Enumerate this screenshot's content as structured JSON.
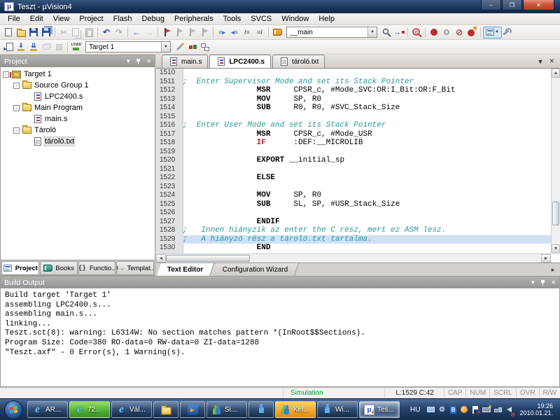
{
  "titlebar": {
    "title": "Teszt - µVision4"
  },
  "window_controls": {
    "minimize": "–",
    "maximize": "❐",
    "close": "✕"
  },
  "menubar": [
    "File",
    "Edit",
    "View",
    "Project",
    "Flash",
    "Debug",
    "Peripherals",
    "Tools",
    "SVCS",
    "Window",
    "Help"
  ],
  "toolbar_main": {
    "combo_value": "__main",
    "left_icons": [
      {
        "name": "new-file"
      },
      {
        "name": "open-file"
      },
      {
        "name": "save-file"
      },
      {
        "name": "save-all"
      },
      {
        "name": "separator"
      },
      {
        "name": "cut",
        "disabled": true
      },
      {
        "name": "copy",
        "disabled": true
      },
      {
        "name": "paste",
        "disabled": true
      },
      {
        "name": "separator"
      },
      {
        "name": "undo"
      },
      {
        "name": "redo",
        "disabled": true
      },
      {
        "name": "separator"
      },
      {
        "name": "nav-back"
      },
      {
        "name": "nav-forward",
        "disabled": true
      },
      {
        "name": "separator"
      },
      {
        "name": "insert-bookmark"
      },
      {
        "name": "next-bookmark",
        "disabled": true
      },
      {
        "name": "prev-bookmark",
        "disabled": true
      },
      {
        "name": "clear-bookmarks",
        "disabled": true
      },
      {
        "name": "separator"
      },
      {
        "name": "indent"
      },
      {
        "name": "unindent"
      },
      {
        "name": "comment-selection"
      },
      {
        "name": "uncomment-selection"
      },
      {
        "name": "separator"
      },
      {
        "name": "book"
      }
    ],
    "right_icons": [
      {
        "name": "find-in-files"
      },
      {
        "name": "goto"
      },
      {
        "name": "separator"
      },
      {
        "name": "debug-session"
      },
      {
        "name": "separator"
      },
      {
        "name": "insert-breakpoint"
      },
      {
        "name": "toggle-breakpoint"
      },
      {
        "name": "disable-all-breakpoints"
      },
      {
        "name": "kill-all-breakpoints"
      },
      {
        "name": "separator"
      },
      {
        "name": "window-list"
      },
      {
        "name": "configure"
      }
    ]
  },
  "toolbar_build": {
    "combo_value": "Target 1",
    "icons_left": [
      {
        "name": "translate"
      },
      {
        "name": "build"
      },
      {
        "name": "rebuild"
      },
      {
        "name": "batch-build",
        "disabled": true
      },
      {
        "name": "stop-build",
        "disabled": true
      },
      {
        "name": "separator"
      },
      {
        "name": "download"
      }
    ],
    "icons_right": [
      {
        "name": "target-options"
      },
      {
        "name": "manage-components"
      },
      {
        "name": "file-extensions"
      }
    ]
  },
  "project_panel": {
    "title": "Project",
    "tree": [
      {
        "label": "Target 1",
        "level": 0,
        "icon": "target",
        "expander": true
      },
      {
        "label": "Source Group 1",
        "level": 1,
        "icon": "folder",
        "expander": true
      },
      {
        "label": "LPC2400.s",
        "level": 2,
        "icon": "asm-file"
      },
      {
        "label": "Main Program",
        "level": 1,
        "icon": "folder",
        "expander": true
      },
      {
        "label": "main.s",
        "level": 2,
        "icon": "asm-file"
      },
      {
        "label": "Tároló",
        "level": 1,
        "icon": "folder",
        "expander": true
      },
      {
        "label": "tároló.txt",
        "level": 2,
        "icon": "text-file",
        "selected": true
      }
    ],
    "tabs": [
      {
        "label": "Project",
        "icon": "project-tab",
        "active": true
      },
      {
        "label": "Books",
        "icon": "books-tab"
      },
      {
        "label": "Functio...",
        "icon": "functions-tab"
      },
      {
        "label": "Templat...",
        "icon": "templates-tab"
      }
    ]
  },
  "editor": {
    "tabs": [
      {
        "label": "main.s",
        "icon": "asm-file"
      },
      {
        "label": "LPC2400.s",
        "icon": "asm-file",
        "active": true
      },
      {
        "label": "tároló.txt",
        "icon": "text-file"
      }
    ],
    "lines": [
      {
        "n": 1510,
        "parts": []
      },
      {
        "n": 1511,
        "parts": [
          {
            "s": "cmt",
            "t": ";  Enter Supervisor Mode and set its Stack Pointer"
          }
        ]
      },
      {
        "n": 1512,
        "parts": [
          {
            "s": "pln",
            "t": "                "
          },
          {
            "s": "kw",
            "t": "MSR"
          },
          {
            "s": "pln",
            "t": "     CPSR_c, #Mode_SVC:OR:I_Bit:OR:F_Bit"
          }
        ]
      },
      {
        "n": 1513,
        "parts": [
          {
            "s": "pln",
            "t": "                "
          },
          {
            "s": "kw",
            "t": "MOV"
          },
          {
            "s": "pln",
            "t": "     SP, R0"
          }
        ]
      },
      {
        "n": 1514,
        "parts": [
          {
            "s": "pln",
            "t": "                "
          },
          {
            "s": "kw",
            "t": "SUB"
          },
          {
            "s": "pln",
            "t": "     R0, R0, #SVC_Stack_Size"
          }
        ]
      },
      {
        "n": 1515,
        "parts": []
      },
      {
        "n": 1516,
        "parts": [
          {
            "s": "cmt",
            "t": ";  Enter User Mode and set its Stack Pointer"
          }
        ]
      },
      {
        "n": 1517,
        "parts": [
          {
            "s": "pln",
            "t": "                "
          },
          {
            "s": "kw",
            "t": "MSR"
          },
          {
            "s": "pln",
            "t": "     CPSR_c, #Mode_USR"
          }
        ]
      },
      {
        "n": 1518,
        "parts": [
          {
            "s": "pln",
            "t": "                "
          },
          {
            "s": "red",
            "t": "IF"
          },
          {
            "s": "pln",
            "t": "      :DEF:__MICROLIB"
          }
        ]
      },
      {
        "n": 1519,
        "parts": []
      },
      {
        "n": 1520,
        "parts": [
          {
            "s": "pln",
            "t": "                "
          },
          {
            "s": "kw",
            "t": "EXPORT"
          },
          {
            "s": "pln",
            "t": " __initial_sp"
          }
        ]
      },
      {
        "n": 1521,
        "parts": []
      },
      {
        "n": 1522,
        "parts": [
          {
            "s": "pln",
            "t": "                "
          },
          {
            "s": "kw",
            "t": "ELSE"
          }
        ]
      },
      {
        "n": 1523,
        "parts": []
      },
      {
        "n": 1524,
        "parts": [
          {
            "s": "pln",
            "t": "                "
          },
          {
            "s": "kw",
            "t": "MOV"
          },
          {
            "s": "pln",
            "t": "     SP, R0"
          }
        ]
      },
      {
        "n": 1525,
        "parts": [
          {
            "s": "pln",
            "t": "                "
          },
          {
            "s": "kw",
            "t": "SUB"
          },
          {
            "s": "pln",
            "t": "     SL, SP, #USR_Stack_Size"
          }
        ]
      },
      {
        "n": 1526,
        "parts": []
      },
      {
        "n": 1527,
        "parts": [
          {
            "s": "pln",
            "t": "                "
          },
          {
            "s": "kw",
            "t": "ENDIF"
          }
        ]
      },
      {
        "n": 1528,
        "parts": [
          {
            "s": "cmt",
            "t": ";   Innen hiányzik az enter the C rész, mert ez ASM lesz."
          }
        ]
      },
      {
        "n": 1529,
        "hl": true,
        "parts": [
          {
            "s": "cmt",
            "t": ";   A hiányzó rész a tároló.txt tartalma."
          }
        ]
      },
      {
        "n": 1530,
        "parts": [
          {
            "s": "pln",
            "t": "                "
          },
          {
            "s": "kw",
            "t": "END"
          }
        ]
      }
    ],
    "bottom_tabs": [
      {
        "label": "Text Editor",
        "active": true
      },
      {
        "label": "Configuration Wizard"
      }
    ]
  },
  "build_output": {
    "title": "Build Output",
    "lines": [
      "Build target 'Target 1'",
      "assembling LPC2400.s...",
      "assembling main.s...",
      "linking...",
      "Teszt.sct(8): warning: L6314W: No section matches pattern *(InRoot$$Sections).",
      "Program Size: Code=380 RO-data=0 RW-data=0 ZI-data=1288",
      "\"Teszt.axf\" - 0 Error(s), 1 Warning(s)."
    ]
  },
  "status_bar": {
    "mode": "Simulation",
    "cursor": "L:1529 C:42",
    "toggles": [
      "CAP",
      "NUM",
      "SCRL",
      "OVR",
      "R/W"
    ]
  },
  "taskbar": {
    "buttons": [
      {
        "label": "AR...",
        "icon": "ie"
      },
      {
        "label": "72...",
        "icon": "ie",
        "state": "progress"
      },
      {
        "label": "Vál...",
        "icon": "ie"
      },
      {
        "label": "",
        "icon": "explorer"
      },
      {
        "label": "",
        "icon": "media-player"
      },
      {
        "label": "Si...",
        "icon": "people"
      },
      {
        "label": "",
        "icon": "messenger"
      },
      {
        "label": "Kel...",
        "icon": "people",
        "state": "attention"
      },
      {
        "label": "Wi...",
        "icon": "messenger"
      },
      {
        "label": "Tes...",
        "icon": "uvision",
        "state": "active"
      }
    ],
    "tray": {
      "lang": "HU",
      "icons": [
        "display",
        "settings",
        "bluetooth",
        "media",
        "action-center",
        "battery",
        "network",
        "volume-muted"
      ],
      "time": "19:26",
      "date": "2010.01.21."
    }
  }
}
